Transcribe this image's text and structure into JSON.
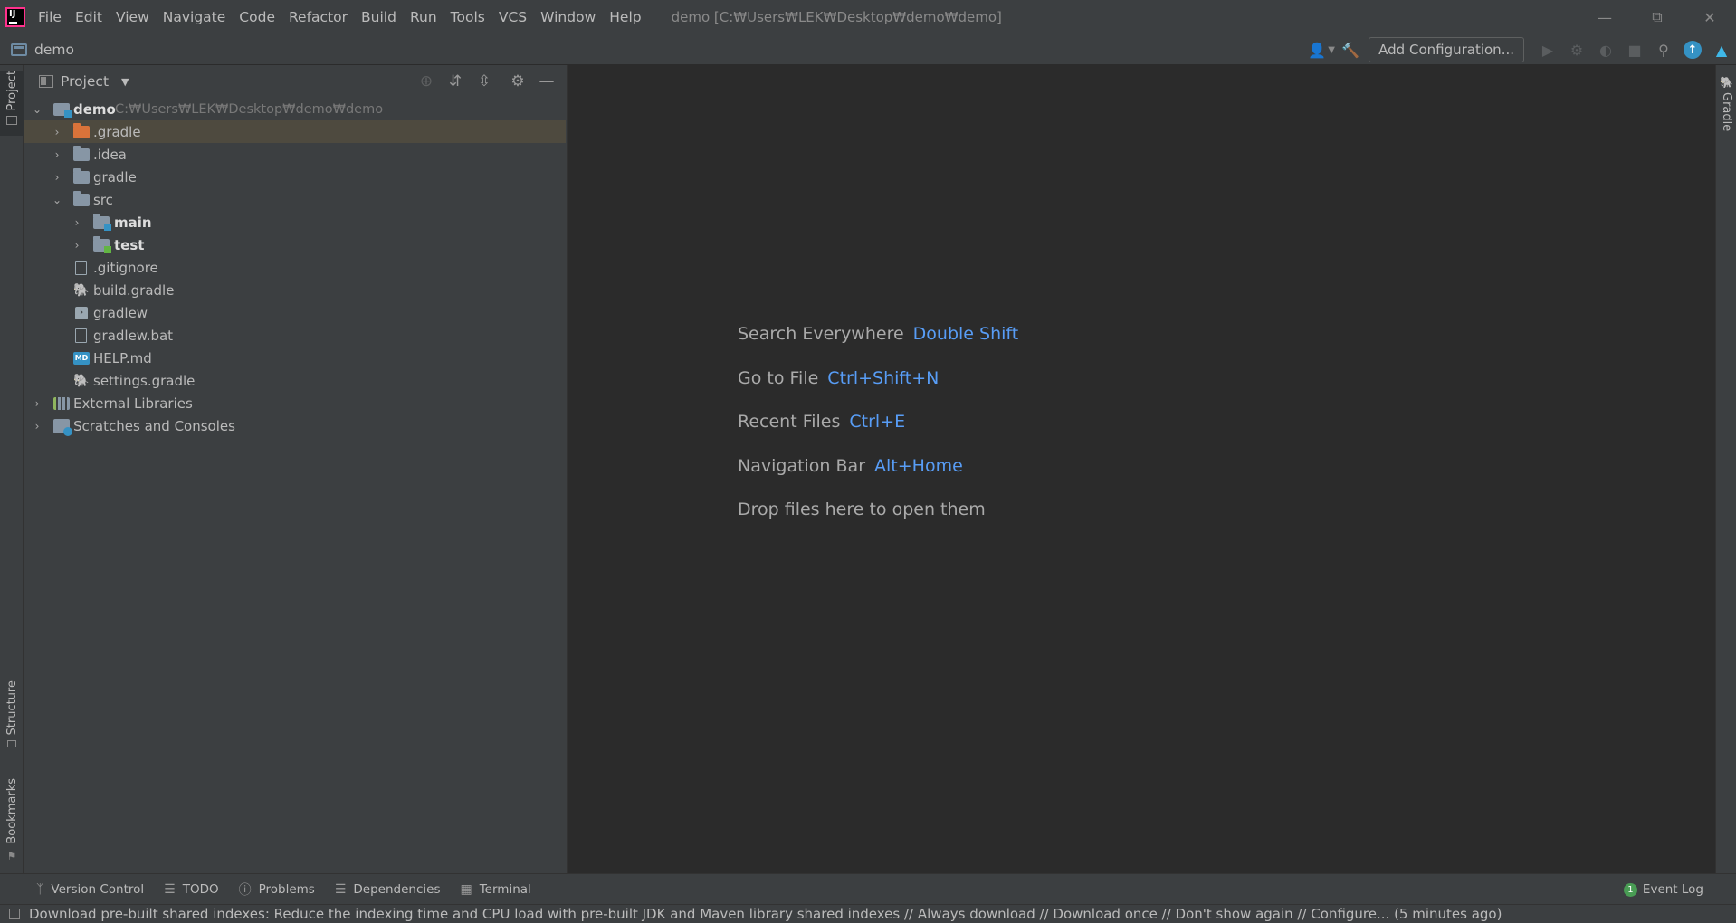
{
  "titlebar": {
    "menus": [
      {
        "name": "menu-file",
        "label": "File"
      },
      {
        "name": "menu-edit",
        "label": "Edit"
      },
      {
        "name": "menu-view",
        "label": "View"
      },
      {
        "name": "menu-navigate",
        "label": "Navigate"
      },
      {
        "name": "menu-code",
        "label": "Code"
      },
      {
        "name": "menu-refactor",
        "label": "Refactor"
      },
      {
        "name": "menu-build",
        "label": "Build"
      },
      {
        "name": "menu-run",
        "label": "Run"
      },
      {
        "name": "menu-tools",
        "label": "Tools"
      },
      {
        "name": "menu-vcs",
        "label": "VCS"
      },
      {
        "name": "menu-window",
        "label": "Window"
      },
      {
        "name": "menu-help",
        "label": "Help"
      }
    ],
    "window_title": "demo [C:₩Users₩LEK₩Desktop₩demo₩demo]"
  },
  "navbar": {
    "project_name": "demo",
    "add_configuration_label": "Add Configuration..."
  },
  "left_strip": {
    "project_tab": "Project",
    "structure_tab": "Structure",
    "bookmarks_tab": "Bookmarks"
  },
  "right_strip": {
    "gradle_tab": "Gradle"
  },
  "project_panel": {
    "title": "Project",
    "root": {
      "label": "demo",
      "path": "C:₩Users₩LEK₩Desktop₩demo₩demo"
    },
    "items": [
      {
        "label": ".gradle"
      },
      {
        "label": ".idea"
      },
      {
        "label": "gradle"
      },
      {
        "label": "src"
      },
      {
        "label": "main"
      },
      {
        "label": "test"
      },
      {
        "label": ".gitignore"
      },
      {
        "label": "build.gradle"
      },
      {
        "label": "gradlew"
      },
      {
        "label": "gradlew.bat"
      },
      {
        "label": "HELP.md"
      },
      {
        "label": "settings.gradle"
      },
      {
        "label": "External Libraries"
      },
      {
        "label": "Scratches and Consoles"
      }
    ]
  },
  "editor": {
    "hints": [
      {
        "text": "Search Everywhere",
        "shortcut": "Double Shift"
      },
      {
        "text": "Go to File",
        "shortcut": "Ctrl+Shift+N"
      },
      {
        "text": "Recent Files",
        "shortcut": "Ctrl+E"
      },
      {
        "text": "Navigation Bar",
        "shortcut": "Alt+Home"
      },
      {
        "text": "Drop files here to open them",
        "shortcut": ""
      }
    ]
  },
  "bottombar": {
    "tabs": [
      {
        "label": "Version Control"
      },
      {
        "label": "TODO"
      },
      {
        "label": "Problems"
      },
      {
        "label": "Dependencies"
      },
      {
        "label": "Terminal"
      }
    ],
    "event_log": {
      "label": "Event Log",
      "count": "1"
    }
  },
  "statusbar": {
    "message": "Download pre-built shared indexes: Reduce the indexing time and CPU load with pre-built JDK and Maven library shared indexes // Always download // Download once // Don't show again // Configure... (5 minutes ago)"
  },
  "colors": {
    "background": "#2b2b2b",
    "panel": "#3c3f41",
    "shortcut": "#589df6",
    "selection_highlight": "#4e4a3f",
    "excluded_folder": "#d9733a"
  }
}
